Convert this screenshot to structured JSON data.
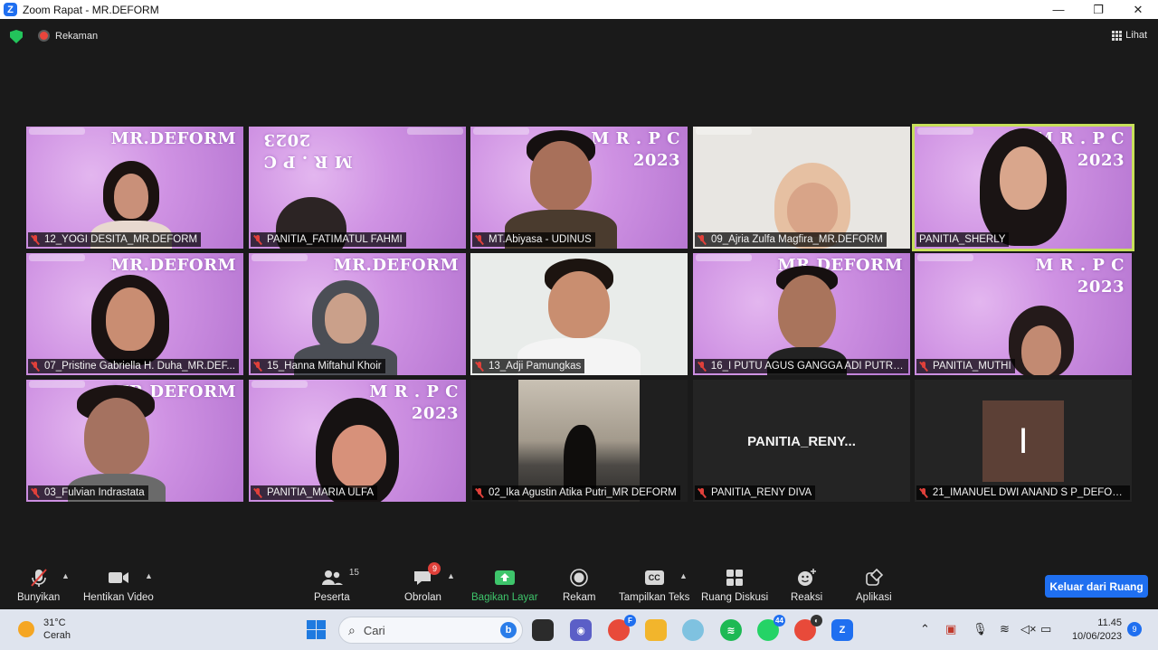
{
  "window": {
    "title": "Zoom Rapat - MR.DEFORM",
    "logo_letter": "Z",
    "minimize": "—",
    "maximize": "❐",
    "close": "✕"
  },
  "topbar": {
    "recording_label": "Rekaman",
    "view_label": "Lihat"
  },
  "tiles": [
    {
      "name": "12_YOGI DESITA_MR.DEFORM",
      "brand": "MR.DEFORM"
    },
    {
      "name": "PANITIA_FATIMATUL FAHMI",
      "brand": "M R . P C\n2023"
    },
    {
      "name": "MT.Abiyasa - UDINUS",
      "brand": "M R . P C\n2023"
    },
    {
      "name": "09_Ajria Zulfa Magfira_MR.DEFORM",
      "brand": ""
    },
    {
      "name": "PANITIA_SHERLY",
      "brand": "M R . P C\n2023",
      "active": true
    },
    {
      "name": "07_Pristine Gabriella H. Duha_MR.DEF...",
      "brand": "MR.DEFORM"
    },
    {
      "name": "15_Hanna Miftahul Khoir",
      "brand": "MR.DEFORM"
    },
    {
      "name": "13_Adji Pamungkas",
      "brand": ""
    },
    {
      "name": "16_I PUTU AGUS GANGGA ADI PUTRA...",
      "brand": "MR.DEFORM"
    },
    {
      "name": "PANITIA_MUTHI",
      "brand": "M R . P C\n2023"
    },
    {
      "name": "03_Fulvian Indrastata",
      "brand": "MR.DEFORM"
    },
    {
      "name": "PANITIA_MARIA ULFA",
      "brand": "M R . P C\n2023"
    },
    {
      "name": "02_Ika Agustin Atika Putri_MR DEFORM",
      "brand": ""
    },
    {
      "name": "PANITIA_RENY DIVA",
      "brand": "",
      "big_name": "PANITIA_RENY..."
    },
    {
      "name": "21_IMANUEL DWI ANAND S P_DEFORM",
      "brand": "",
      "avatar_letter": "I"
    }
  ],
  "toolbar": {
    "unmute": "Bunyikan",
    "stop_video": "Hentikan Video",
    "participants": "Peserta",
    "participants_count": "15",
    "chat": "Obrolan",
    "chat_badge": "9",
    "share": "Bagikan Layar",
    "record": "Rekam",
    "captions": "Tampilkan Teks",
    "captions_icon": "CC",
    "breakout": "Ruang Diskusi",
    "reactions": "Reaksi",
    "apps": "Aplikasi",
    "leave": "Keluar dari Ruang"
  },
  "taskbar": {
    "temperature": "31°C",
    "weather": "Cerah",
    "search_placeholder": "Cari",
    "time": "11.45",
    "date": "10/06/2023",
    "notifications": "9",
    "whatsapp_badge": "44"
  },
  "colors": {
    "accent": "#1f6ff0",
    "active_speaker": "#c7e05a",
    "muted": "#e0403a",
    "share_green": "#3ec56b"
  }
}
